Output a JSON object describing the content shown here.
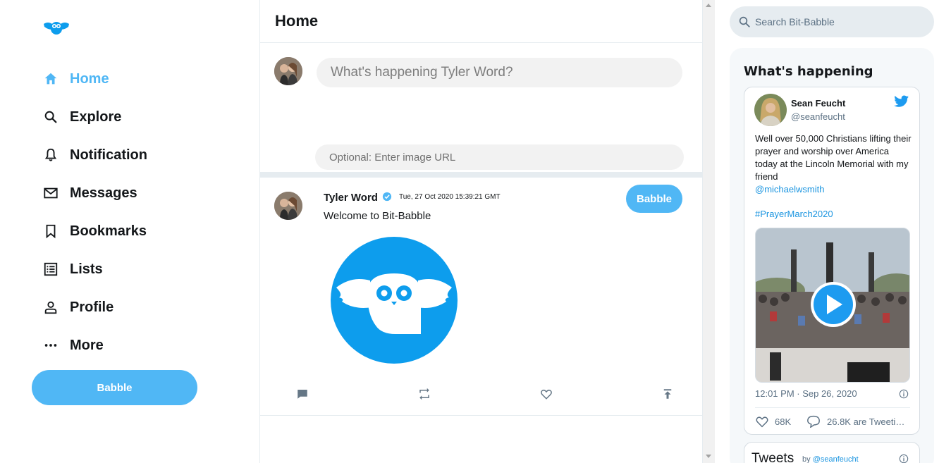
{
  "sidebar": {
    "logo": "owl-logo",
    "items": [
      {
        "label": "Home",
        "icon": "home-icon",
        "active": true
      },
      {
        "label": "Explore",
        "icon": "search-icon"
      },
      {
        "label": "Notification",
        "icon": "bell-icon"
      },
      {
        "label": "Messages",
        "icon": "mail-icon"
      },
      {
        "label": "Bookmarks",
        "icon": "bookmark-icon"
      },
      {
        "label": "Lists",
        "icon": "list-icon"
      },
      {
        "label": "Profile",
        "icon": "person-icon"
      },
      {
        "label": "More",
        "icon": "more-icon"
      }
    ],
    "babble_button": "Babble"
  },
  "feed": {
    "title": "Home",
    "composer": {
      "placeholder": "What's happening Tyler Word?",
      "image_url_placeholder": "Optional: Enter image URL",
      "submit_label": "Babble"
    },
    "posts": [
      {
        "display_name": "Tyler Word",
        "verified": true,
        "timestamp": "Tue, 27 Oct 2020 15:39:21 GMT",
        "text": "Welcome to Bit-Babble",
        "image": "bit-babble-owl-logo",
        "actions": [
          "comment-icon",
          "retweet-icon",
          "like-icon",
          "share-icon"
        ]
      }
    ]
  },
  "widgets": {
    "search_placeholder": "Search Bit-Babble",
    "title": "What's happening",
    "embedded_tweet": {
      "name": "Sean Feucht",
      "handle": "@seanfeucht",
      "text": "Well over 50,000 Christians lifting their prayer and worship over America today at the Lincoln Memorial with my friend",
      "mention": "@michaelwsmith",
      "hashtag": "#PrayerMarch2020",
      "meta": "12:01 PM · Sep 26, 2020",
      "likes": "68K",
      "retweets": "26.8K are Tweeti…"
    },
    "timeline": {
      "title": "Tweets",
      "by": "by",
      "handle": "@seanfeucht"
    }
  },
  "colors": {
    "accent": "#50b7f5",
    "logo_blue": "#0d9ded",
    "twitter_blue": "#1d9bf0",
    "divider": "#e6ecf0",
    "widget_bg": "#f5f8fa"
  }
}
